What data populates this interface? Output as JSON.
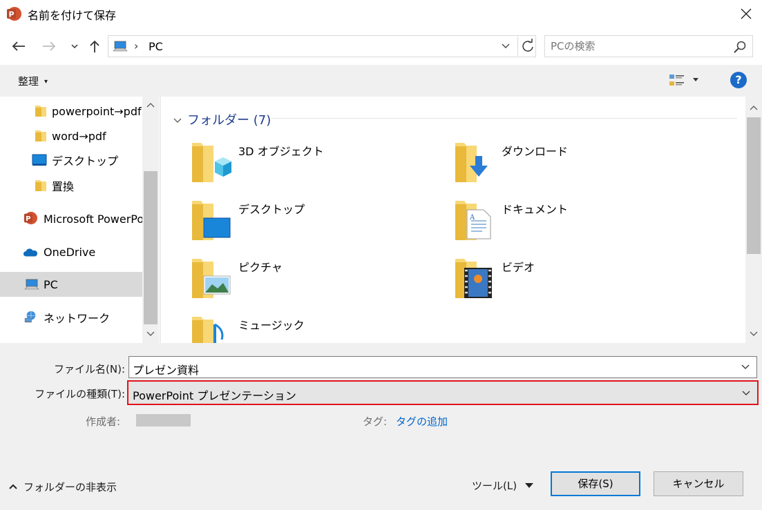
{
  "window": {
    "title": "名前を付けて保存",
    "app_icon": "powerpoint-icon",
    "close_icon": "close-icon"
  },
  "navigation": {
    "back_icon": "arrow-left-icon",
    "forward_icon": "arrow-right-icon",
    "recent_icon": "chevron-down-icon",
    "up_icon": "arrow-up-icon",
    "address": {
      "icon": "pc-icon",
      "separator": "›",
      "crumb": "PC",
      "refresh_icon": "refresh-icon"
    },
    "search": {
      "placeholder": "PCの検索",
      "value": "",
      "icon": "search-icon"
    }
  },
  "toolbar": {
    "organize_label": "整理",
    "organize_caret": "▾",
    "view_icon": "view-options-icon",
    "help_label": "?"
  },
  "nav_pane": {
    "items": [
      {
        "label": "powerpoint→pdf",
        "icon": "folder-icon",
        "selected": false
      },
      {
        "label": "word→pdf",
        "icon": "folder-icon",
        "selected": false
      },
      {
        "label": "デスクトップ",
        "icon": "desktop-icon",
        "selected": false
      },
      {
        "label": "置換",
        "icon": "folder-icon",
        "selected": false
      },
      {
        "label": "Microsoft PowerPoint",
        "icon": "powerpoint-icon",
        "selected": false
      },
      {
        "label": "OneDrive",
        "icon": "onedrive-icon",
        "selected": false
      },
      {
        "label": "PC",
        "icon": "pc-icon",
        "selected": true
      },
      {
        "label": "ネットワーク",
        "icon": "network-icon",
        "selected": false
      }
    ]
  },
  "content": {
    "group_header": "フォルダー (7)",
    "folders": [
      {
        "label": "3D オブジェクト",
        "icon": "3d-objects-folder-icon"
      },
      {
        "label": "ダウンロード",
        "icon": "downloads-folder-icon"
      },
      {
        "label": "デスクトップ",
        "icon": "desktop-folder-icon"
      },
      {
        "label": "ドキュメント",
        "icon": "documents-folder-icon"
      },
      {
        "label": "ピクチャ",
        "icon": "pictures-folder-icon"
      },
      {
        "label": "ビデオ",
        "icon": "videos-folder-icon"
      },
      {
        "label": "ミュージック",
        "icon": "music-folder-icon"
      }
    ]
  },
  "form": {
    "filename_label": "ファイル名(N):",
    "filename_value": "プレゼン資料",
    "filetype_label": "ファイルの種類(T):",
    "filetype_value": "PowerPoint プレゼンテーション",
    "author_label": "作成者:",
    "tags_label": "タグ:",
    "tags_link": "タグの追加",
    "highlight_color": "#e1121b"
  },
  "footer": {
    "hide_folders_label": "フォルダーの非表示",
    "tools_label": "ツール(L)",
    "save_label": "保存(S)",
    "cancel_label": "キャンセル"
  }
}
